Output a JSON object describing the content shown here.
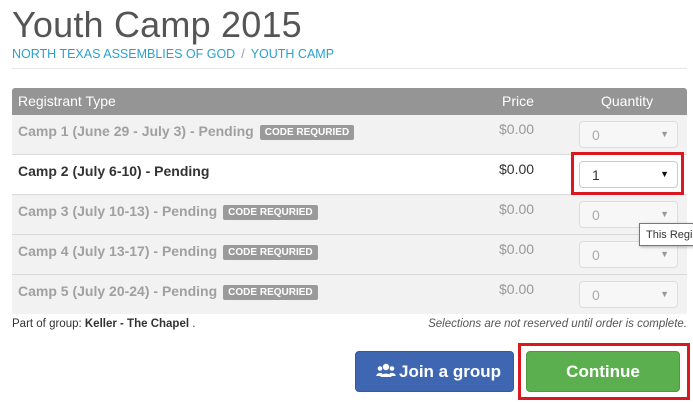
{
  "page": {
    "title": "Youth Camp 2015",
    "breadcrumbs": [
      "NORTH TEXAS ASSEMBLIES OF GOD",
      "YOUTH CAMP"
    ],
    "breadcrumb_separator": "/"
  },
  "table": {
    "headers": {
      "type": "Registrant Type",
      "price": "Price",
      "quantity": "Quantity"
    },
    "rows": [
      {
        "type": "Camp 1 (June 29 - July 3) - Pending",
        "badge": "CODE REQURIED",
        "price": "$0.00",
        "quantity": "0",
        "enabled": false
      },
      {
        "type": "Camp 2 (July 6-10) - Pending",
        "badge": "",
        "price": "$0.00",
        "quantity": "1",
        "enabled": true
      },
      {
        "type": "Camp 3 (July 10-13) - Pending",
        "badge": "CODE REQURIED",
        "price": "$0.00",
        "quantity": "0",
        "enabled": false
      },
      {
        "type": "Camp 4 (July 13-17) - Pending",
        "badge": "CODE REQURIED",
        "price": "$0.00",
        "quantity": "0",
        "enabled": false
      },
      {
        "type": "Camp 5 (July 20-24) - Pending",
        "badge": "CODE REQURIED",
        "price": "$0.00",
        "quantity": "0",
        "enabled": false
      }
    ]
  },
  "tooltip": "This Regi",
  "footer": {
    "group_prefix": "Part of group: ",
    "group_name": "Keller - The Chapel",
    "group_suffix": " .",
    "note": "Selections are not reserved until order is complete."
  },
  "buttons": {
    "join_label": "Join a group",
    "join_icon": "users-icon",
    "continue_label": "Continue"
  },
  "colors": {
    "link": "#2aa0cf",
    "header_bg": "#959595",
    "join_button": "#3f67b1",
    "continue_button": "#5caf4e",
    "highlight": "#d9191f"
  }
}
